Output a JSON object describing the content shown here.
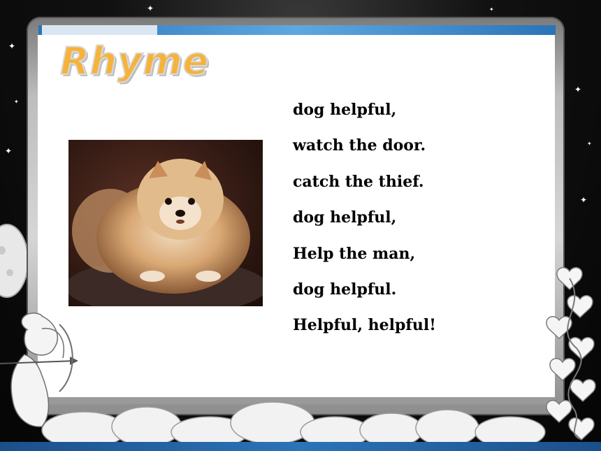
{
  "slide": {
    "title": "Rhyme",
    "lines": [
      "dog helpful,",
      "watch the door.",
      "catch the thief.",
      "dog helpful,",
      "Help the man,",
      "dog helpful.",
      "Helpful, helpful!"
    ]
  },
  "colors": {
    "title": "#f6b23a",
    "accent_bar": "#2b74b8",
    "panel": "#ffffff",
    "frame": "#bdbdbd"
  },
  "icons": [
    "star-icon",
    "cupid-illustration",
    "heart-vine-decoration",
    "cloud-decoration",
    "moon-decoration"
  ]
}
